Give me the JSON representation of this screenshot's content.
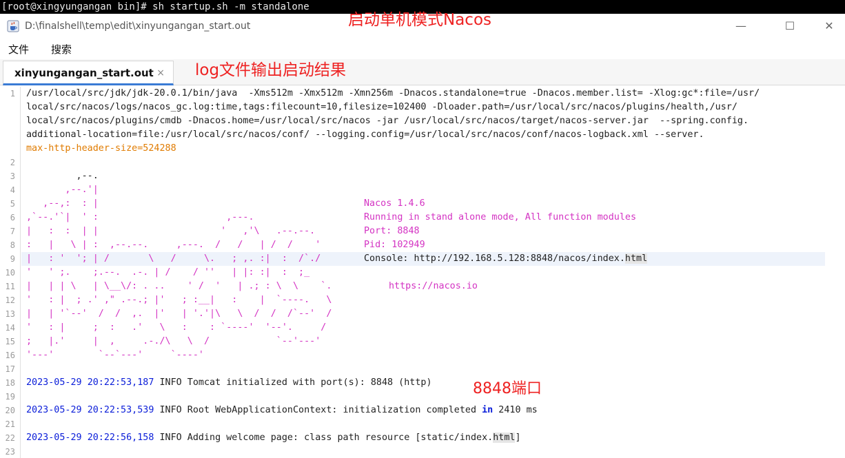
{
  "terminal": {
    "command": "[root@xingyungangan bin]# sh startup.sh -m standalone"
  },
  "window": {
    "title": "D:\\finalshell\\temp\\edit\\xinyungangan_start.out",
    "minimize": "—",
    "maximize": "☐",
    "close": "✕"
  },
  "menu": {
    "file": "文件",
    "search": "搜索"
  },
  "tab": {
    "label": "xinyungangan_start.out",
    "close": "×"
  },
  "annotations": {
    "top": "启动单机模式Nacos",
    "log": "log文件输出启动结果",
    "port": "8848端口"
  },
  "editor": {
    "line_numbers": [
      "1",
      "2",
      "3",
      "4",
      "5",
      "6",
      "7",
      "8",
      "9",
      "10",
      "11",
      "12",
      "13",
      "14",
      "15",
      "16",
      "17",
      "18",
      "19",
      "20",
      "21",
      "22",
      "23"
    ],
    "line1": [
      "/usr/local/src/jdk/jdk-20.0.1/bin/java  -Xms512m -Xmx512m -Xmn256m -Dnacos.standalone=true -Dnacos.member.list= -Xlog:gc*:file=/usr/",
      "local/src/nacos/logs/nacos_gc.log:time,tags:filecount=10,filesize=102400 -Dloader.path=/usr/local/src/nacos/plugins/health,/usr/",
      "local/src/nacos/plugins/cmdb -Dnacos.home=/usr/local/src/nacos -jar /usr/local/src/nacos/target/nacos-server.jar  --spring.config.",
      "additional-location=file:/usr/local/src/nacos/conf/ --logging.config=/usr/local/src/nacos/conf/nacos-logback.xml --server.",
      "max-http-header-size=524288"
    ],
    "ascii_art": [
      "",
      "         ,--.",
      "       ,--.'|",
      "   ,--,:  : |",
      ",`--.'`|  ' :                       ,---.",
      "|   :  :  | |                      '   ,'\\   .--.--.",
      ":   |   \\ | :  ,--.--.     ,---.  /   /   | /  /    '",
      "|   : '  '; | /       \\   /     \\.   ; ,. :|  :  /`./",
      "'   ' ;.    ;.--.  .-. | /    / ''   | |: :|  :  ;_",
      "|   | | \\   | \\__\\/: . ..    ' /  '   | .; : \\  \\    `.",
      "'   : |  ; .' ,\" .--.; |'   ; :__|   :    |  `----.   \\",
      "|   | '`--'  /  /  ,.  |'   | '.'|\\   \\  /  /  /`--'  /",
      "'   : |     ;  :   .'   \\   :    : `----'  '--'.     /",
      ";   |.'     |  ,     .-./\\   \\  /            `--'---'",
      "'---'        `--`---'     `----'"
    ],
    "info": {
      "version": "Nacos 1.4.6",
      "mode": "Running in stand alone mode, All function modules",
      "port": "Port: 8848",
      "pid": "Pid: 102949",
      "console_prefix": "Console: http://192.168.5.128:8848/nacos/index.",
      "console_ext": "html",
      "site": "https://nacos.io"
    },
    "log18": {
      "date": "2023-05-29",
      "time": "20:22:53,187",
      "text": " INFO Tomcat initialized with port(s): 8848 (http)"
    },
    "log20": {
      "date": "2023-05-29",
      "time": "20:22:53,539",
      "text_a": " INFO Root WebApplicationContext: initialization completed ",
      "kw": "in",
      "text_b": " 2410 ms"
    },
    "log22": {
      "date": "2023-05-29",
      "time": "20:22:56,158",
      "text_a": " INFO Adding welcome page: class path resource [static/index.",
      "ext": "html",
      "text_b": "]"
    }
  }
}
